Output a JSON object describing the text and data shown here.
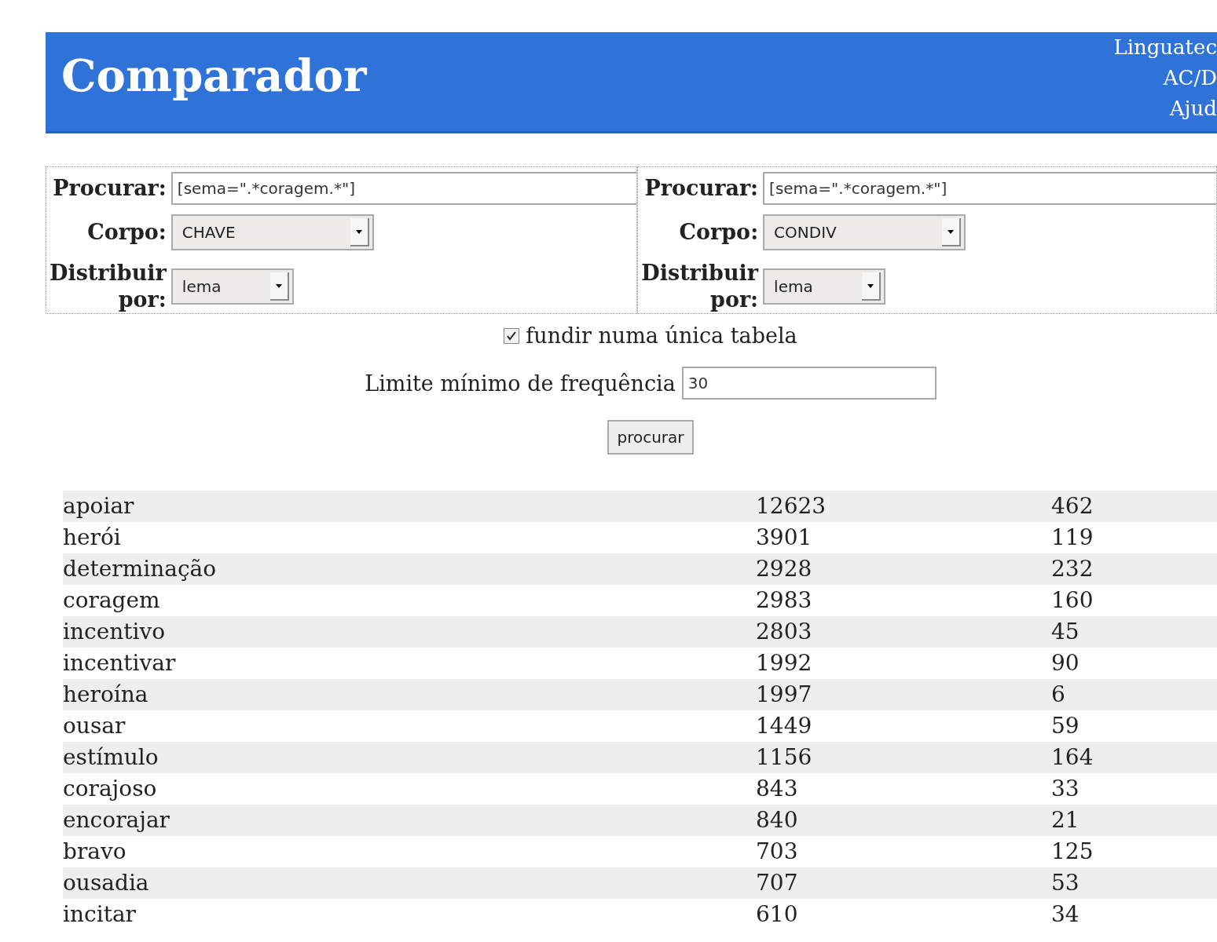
{
  "header": {
    "title": "Comparador",
    "links": [
      "Linguatec",
      "AC/D",
      "Ajud"
    ]
  },
  "queries": [
    {
      "search_label": "Procurar:",
      "search_value": "[sema=\".*coragem.*\"]",
      "corpus_label": "Corpo:",
      "corpus_value": "CHAVE",
      "distribute_label": [
        "Distribuir",
        "por:"
      ],
      "distribute_value": "lema"
    },
    {
      "search_label": "Procurar:",
      "search_value": "[sema=\".*coragem.*\"]",
      "corpus_label": "Corpo:",
      "corpus_value": "CONDIV",
      "distribute_label": [
        "Distribuir",
        "por:"
      ],
      "distribute_value": "lema"
    }
  ],
  "merge": {
    "label": "fundir numa única tabela",
    "checked": true
  },
  "min_freq": {
    "label": "Limite mínimo de frequência",
    "value": "30"
  },
  "submit": "procurar",
  "table": {
    "rows": [
      [
        "apoiar",
        "12623",
        "462"
      ],
      [
        "herói",
        "3901",
        "119"
      ],
      [
        "determinação",
        "2928",
        "232"
      ],
      [
        "coragem",
        "2983",
        "160"
      ],
      [
        "incentivo",
        "2803",
        "45"
      ],
      [
        "incentivar",
        "1992",
        "90"
      ],
      [
        "heroína",
        "1997",
        "6"
      ],
      [
        "ousar",
        "1449",
        "59"
      ],
      [
        "estímulo",
        "1156",
        "164"
      ],
      [
        "corajoso",
        "843",
        "33"
      ],
      [
        "encorajar",
        "840",
        "21"
      ],
      [
        "bravo",
        "703",
        "125"
      ],
      [
        "ousadia",
        "707",
        "53"
      ],
      [
        "incitar",
        "610",
        "34"
      ]
    ]
  }
}
